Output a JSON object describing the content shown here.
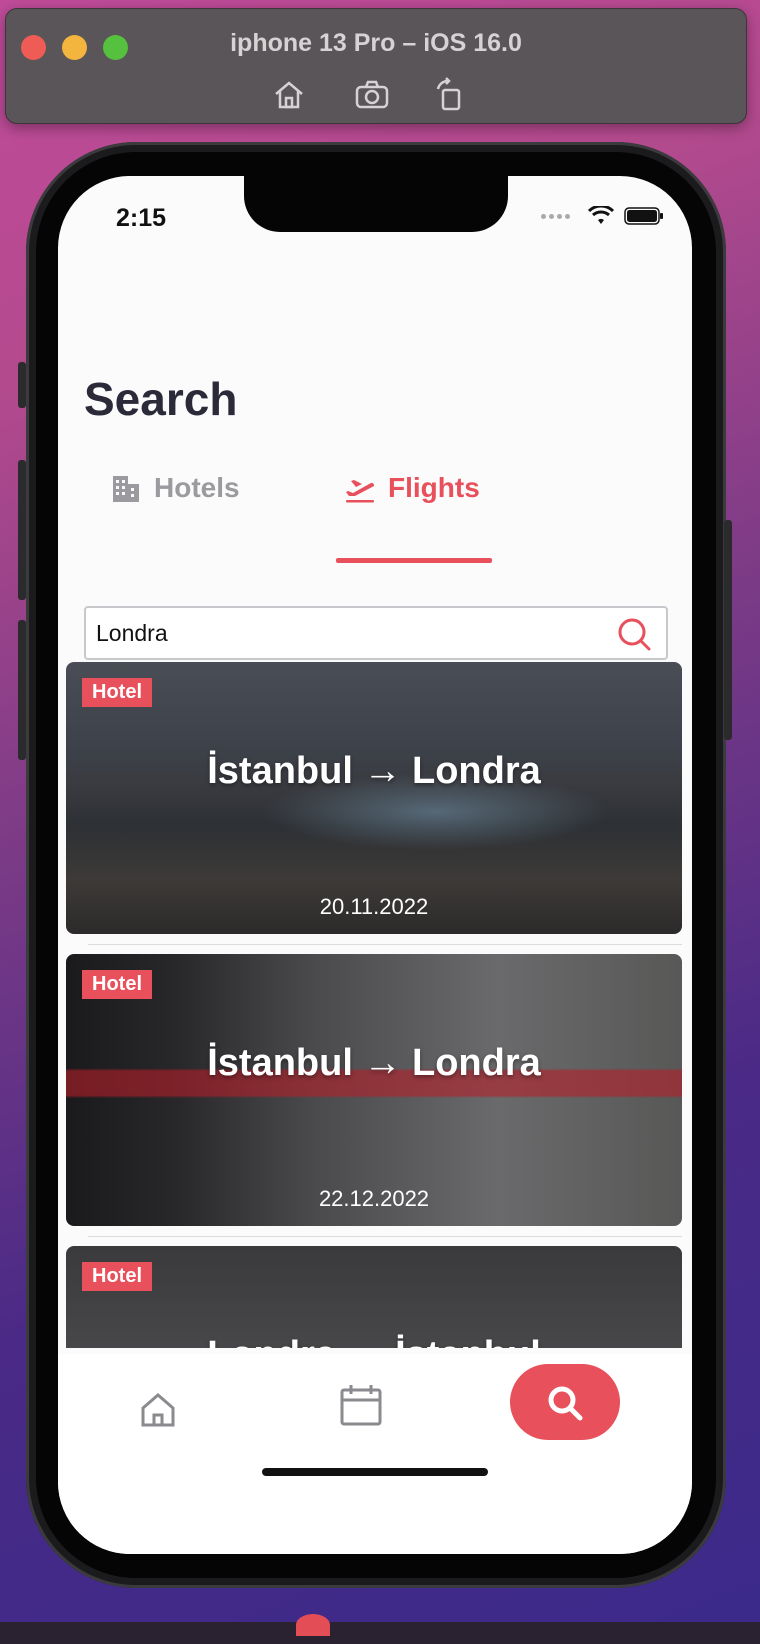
{
  "window": {
    "title": "iphone 13 Pro – iOS 16.0",
    "tools": [
      "home-icon",
      "screenshot-icon",
      "rotate-icon"
    ]
  },
  "status_bar": {
    "time": "2:15"
  },
  "page": {
    "title": "Search"
  },
  "tabs": [
    {
      "label": "Hotels",
      "icon": "building-icon",
      "active": false
    },
    {
      "label": "Flights",
      "icon": "plane-takeoff-icon",
      "active": true
    }
  ],
  "search": {
    "value": "Londra",
    "placeholder": ""
  },
  "results": [
    {
      "badge": "Hotel",
      "route": "İstanbul → Londra",
      "date": "20.11.2022"
    },
    {
      "badge": "Hotel",
      "route": "İstanbul → Londra",
      "date": "22.12.2022"
    },
    {
      "badge": "Hotel",
      "route": "Londra → İstanbul",
      "date": ""
    }
  ],
  "bottom_nav": {
    "items": [
      "home-icon",
      "calendar-icon",
      "search-icon"
    ],
    "active": "search-icon"
  },
  "colors": {
    "accent": "#e8505b",
    "title": "#2a2a38",
    "inactive": "#9a9a9f"
  }
}
